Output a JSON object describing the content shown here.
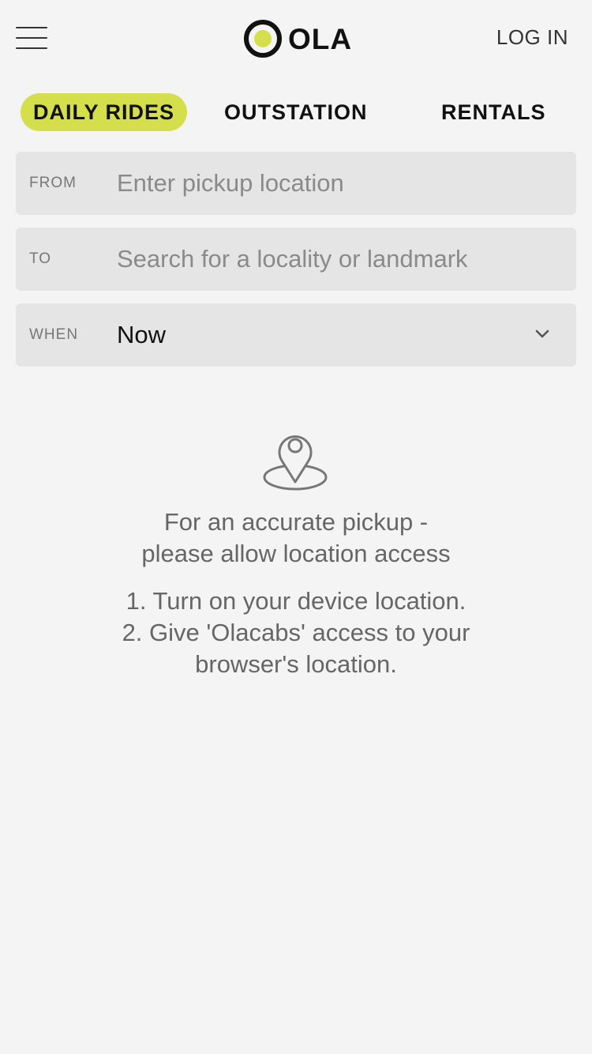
{
  "header": {
    "menu_icon": "hamburger-menu-icon",
    "logo_text": "OLA",
    "logo_colors": {
      "ring": "#111111",
      "dot": "#d4df4b"
    },
    "login_label": "LOG IN"
  },
  "tabs": [
    {
      "label": "DAILY RIDES",
      "active": true
    },
    {
      "label": "OUTSTATION",
      "active": false
    },
    {
      "label": "RENTALS",
      "active": false
    }
  ],
  "form": {
    "from": {
      "label": "FROM",
      "placeholder": "Enter pickup location",
      "value": ""
    },
    "to": {
      "label": "TO",
      "placeholder": "Search for a locality or landmark",
      "value": ""
    },
    "when": {
      "label": "WHEN",
      "value": "Now",
      "icon": "chevron-down-icon"
    }
  },
  "location_notice": {
    "icon": "location-pin-icon",
    "title_line1": "For an accurate pickup -",
    "title_line2": "please allow location access",
    "step1": "1. Turn on your device location.",
    "step2_line1": "2. Give 'Olacabs' access to your",
    "step2_line2": "browser's location."
  },
  "colors": {
    "accent": "#d4df4b",
    "background": "#f4f4f4",
    "field_background": "#e5e5e5"
  }
}
